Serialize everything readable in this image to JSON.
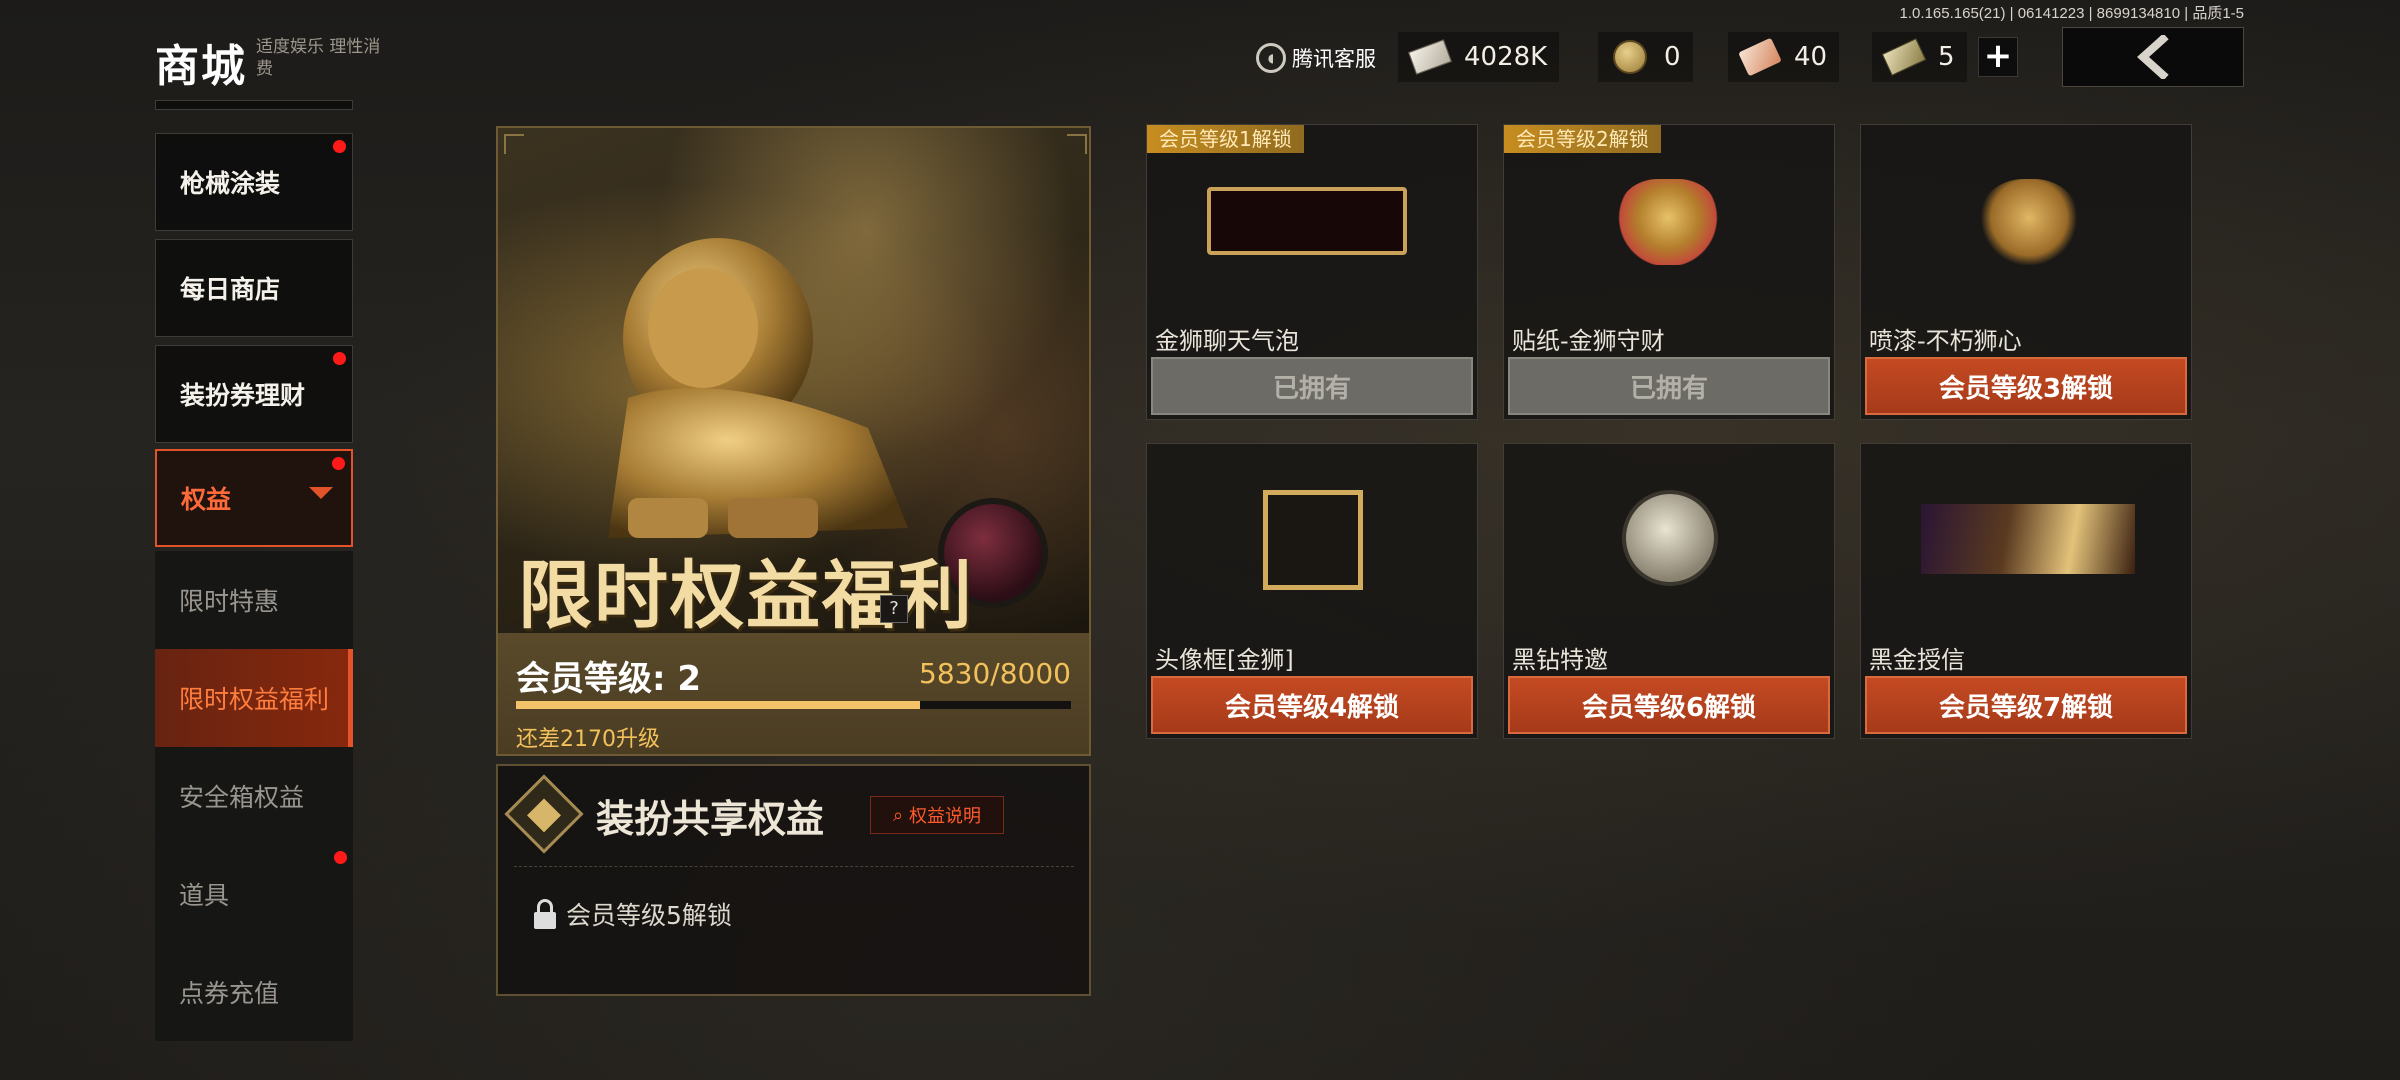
{
  "version": "1.0.165.165(21) | 06141223 | 8699134810 | 品质1-5",
  "header": {
    "title": "商城",
    "subtitle": "适度娱乐 理性消费",
    "support": "腾讯客服",
    "currencies": [
      {
        "icon": "ticket-icon",
        "value": "4028K"
      },
      {
        "icon": "coin-icon",
        "value": "0"
      },
      {
        "icon": "card-icon",
        "value": "40"
      },
      {
        "icon": "bill-icon",
        "value": "5"
      }
    ],
    "plus": "+",
    "back_icon": "back-arrow-icon"
  },
  "sidebar": {
    "items": [
      {
        "label": "枪械涂装",
        "dot": true
      },
      {
        "label": "每日商店",
        "dot": false
      },
      {
        "label": "装扮券理财",
        "dot": true
      },
      {
        "label": "权益",
        "dot": true,
        "active": true
      },
      {
        "label": "限时特惠"
      },
      {
        "label": "限时权益福利",
        "active": true
      },
      {
        "label": "安全箱权益"
      },
      {
        "label": "道具",
        "dot": true
      },
      {
        "label": "点券充值"
      }
    ]
  },
  "hero": {
    "title": "限时权益福利",
    "help": "?",
    "level_label": "会员等级: 2",
    "progress_text": "5830/8000",
    "progress_fraction": 0.7288,
    "need_text": "还差2170升级"
  },
  "share": {
    "title": "装扮共享权益",
    "help_label": "权益说明",
    "lock_text": "会员等级5解锁"
  },
  "rewards": [
    {
      "tag": "会员等级1解锁",
      "name": "金狮聊天气泡",
      "button": "已拥有",
      "owned": true
    },
    {
      "tag": "会员等级2解锁",
      "name": "贴纸-金狮守财",
      "button": "已拥有",
      "owned": true
    },
    {
      "tag": "",
      "name": "喷漆-不朽狮心",
      "button": "会员等级3解锁",
      "owned": false
    },
    {
      "tag": "",
      "name": "头像框[金狮]",
      "button": "会员等级4解锁",
      "owned": false
    },
    {
      "tag": "",
      "name": "黑钻特邀",
      "button": "会员等级6解锁",
      "owned": false
    },
    {
      "tag": "",
      "name": "黑金授信",
      "button": "会员等级7解锁",
      "owned": false
    }
  ],
  "colors": {
    "accent": "#e2532a",
    "gold": "#f2c15c",
    "notify_dot": "#ff1a1a"
  }
}
